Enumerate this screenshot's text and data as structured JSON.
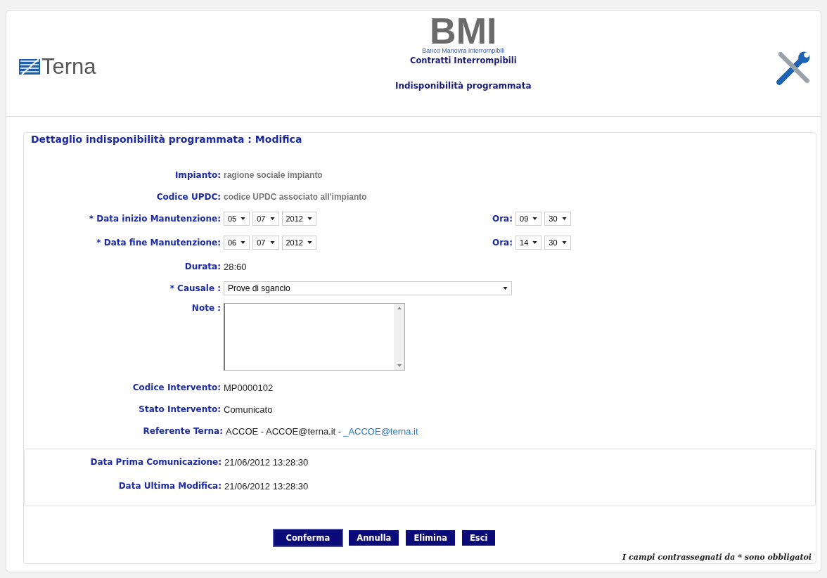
{
  "header": {
    "logo": "Terna",
    "app_name": "BMI",
    "app_subtitle": "Banco Manovra Interrompibili",
    "section": "Contratti Interrompibili",
    "page": "Indisponibilità programmata"
  },
  "form": {
    "title": "Dettaglio indisponibilità programmata : Modifica",
    "fields": [
      {
        "kind": "text",
        "label": "Impianto:",
        "value": "ragione sociale impianto",
        "muted": true
      },
      {
        "kind": "text",
        "label": "Codice UPDC:",
        "value": "codice UPDC associato all'impianto",
        "muted": true
      },
      {
        "kind": "datetime",
        "label": "* Data inizio Manutenzione:",
        "date": [
          "05",
          "07",
          "2012"
        ],
        "time_label": "Ora:",
        "time": [
          "09",
          "30"
        ]
      },
      {
        "kind": "datetime",
        "label": "* Data fine Manutenzione:",
        "date": [
          "06",
          "07",
          "2012"
        ],
        "time_label": "Ora:",
        "time": [
          "14",
          "30"
        ]
      },
      {
        "kind": "text",
        "label": "Durata:",
        "value": "28:60",
        "muted": false
      },
      {
        "kind": "select",
        "label": "* Causale :",
        "value": "Prove di sgancio"
      },
      {
        "kind": "textarea",
        "label": "Note :"
      },
      {
        "kind": "text",
        "label": "Codice Intervento:",
        "value": "MP0000102",
        "muted": false
      },
      {
        "kind": "text",
        "label": "Stato Intervento:",
        "value": "Comunicato",
        "muted": false
      },
      {
        "kind": "link",
        "label": "Referente Terna:",
        "value": "ACCOE - ACCOE@terna.it - ",
        "link": "_ACCOE@terna.it"
      }
    ],
    "dates": [
      {
        "label": "Data Prima Comunicazione:",
        "value": "21/06/2012 13:28:30"
      },
      {
        "label": "Data Ultima Modifica:",
        "value": "21/06/2012 13:28:30"
      }
    ],
    "buttons": [
      {
        "label": "Conferma",
        "focused": true
      },
      {
        "label": "Annulla",
        "focused": false
      },
      {
        "label": "Elimina",
        "focused": false
      },
      {
        "label": "Esci",
        "focused": false
      }
    ],
    "footnote": "I campi contrassegnati da * sono obbligatoi"
  }
}
